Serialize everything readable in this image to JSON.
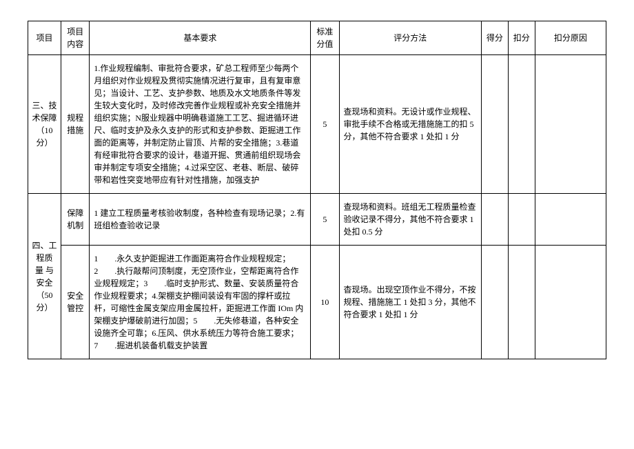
{
  "headers": {
    "project": "项目",
    "content": "项目内容",
    "requirements": "基本要求",
    "standard_score": "标准分值",
    "scoring_method": "评分方法",
    "got_score": "得分",
    "deduct_score": "扣分",
    "deduct_reason": "扣分原因"
  },
  "rows": [
    {
      "project": "三、技术保障（10 分）",
      "content": "规程措施",
      "requirements": "1.作业规程编制、审批符合要求，矿总工程师至少每两个月组织对作业规程及贯彻实施情况进行复审，且有复审意见；当设计、工艺、支护参数、地质及水文地质条件等发生较大变化时，及时修改完善作业规程或补充安全措施并组织实施；N服业规器中明确巷道施工工艺、掘进循环进尺、临时支护及永久支护的形式和支护参数、距掘进工作面的距离等，并制定防止冒顶、片帮的安全措施；3.巷道有经审批符合要求的设计，巷道开掘、贯通前组织现场会审并制定专项安全措施；4.过采空区、老巷、断层、破碎带和岩性突变地带应有针对性措施，加强支护",
      "standard_score": "5",
      "scoring_method": "查现场和资料。无设计或作业规程、审批手续不合格或无措施施工的扣 5 分，其他不符合要求 1 处扣 1 分"
    },
    {
      "project": "四、工程质 量 与安全（50 分）",
      "content": "保障机制",
      "requirements": "1 建立工程质量考核验收制度，各种检查有现场记录；2.有班组检查验收记录",
      "standard_score": "5",
      "scoring_method": "查现场和资料。班组无工程质量检查验收记录不得分，其他不符合要求 1 处扣 0.5 分"
    },
    {
      "project": "",
      "content": "安全管控",
      "requirements": "1　　.永久支护距掘进工作面距离符合作业规程规定；2　　.执行敲帮问顶制度，无空顶作业，空帮距离符合作业规程规定；3　　.临时支护形式、数量、安装质量符合作业规程要求；4.架棚支护棚间装设有牢固的撑杆或拉杆，可缩性金属支架应用金属拉杆，距掘进工作面 IOm 内架棚支护爆破前进行加固；5　　.无失修巷道，各种安全设施齐全可靠；6.压风、供水系统压力等符合施工要求；7　　.掘进机装备机载支护装置",
      "standard_score": "10",
      "scoring_method": "杳现场。出现空顶作业不得分，不按规程、措施施工 1 处扣 3 分，其他不符合要求 1 处扣 1 分"
    }
  ]
}
